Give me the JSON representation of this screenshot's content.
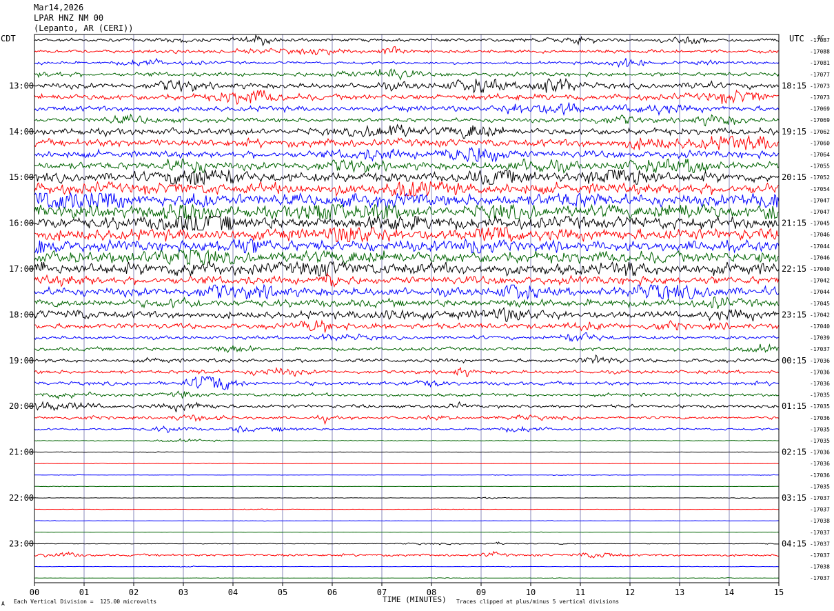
{
  "header": {
    "date": "Mar14,2026",
    "station": "LPAR HNZ NM 00",
    "location": "(Lepanto, AR (CERI))"
  },
  "left_zone": "CDT",
  "right_zone": "UTC",
  "right_top_corner": "0C",
  "footer": {
    "xlabel": "TIME (MINUTES)",
    "left_note": "Each Vertical Division =  125.00 microvolts",
    "right_note": "Traces clipped at plus/minus 5 vertical divisions",
    "corner_mark": "A"
  },
  "colors": {
    "cycle": [
      "#000000",
      "#ff0000",
      "#0000ff",
      "#006400"
    ],
    "grid": "#6a6aa8",
    "frame": "#000000"
  },
  "chart_data": {
    "type": "line",
    "title": "",
    "xlabel": "TIME (MINUTES)",
    "ylabel": "",
    "xlim": [
      0,
      15
    ],
    "x_tick_labels": [
      "00",
      "01",
      "02",
      "03",
      "04",
      "05",
      "06",
      "07",
      "08",
      "09",
      "10",
      "11",
      "12",
      "13",
      "14",
      "15"
    ],
    "trace_minutes": 15,
    "left_hour_labels": [
      {
        "trace_index": 4,
        "label": "13:00"
      },
      {
        "trace_index": 8,
        "label": "14:00"
      },
      {
        "trace_index": 12,
        "label": "15:00"
      },
      {
        "trace_index": 16,
        "label": "16:00"
      },
      {
        "trace_index": 20,
        "label": "17:00"
      },
      {
        "trace_index": 24,
        "label": "18:00"
      },
      {
        "trace_index": 28,
        "label": "19:00"
      },
      {
        "trace_index": 32,
        "label": "20:00"
      },
      {
        "trace_index": 36,
        "label": "21:00"
      },
      {
        "trace_index": 40,
        "label": "22:00"
      },
      {
        "trace_index": 44,
        "label": "23:00"
      }
    ],
    "right_time_labels": [
      {
        "trace_index": 4,
        "label": "18:15"
      },
      {
        "trace_index": 8,
        "label": "19:15"
      },
      {
        "trace_index": 12,
        "label": "20:15"
      },
      {
        "trace_index": 16,
        "label": "21:15"
      },
      {
        "trace_index": 20,
        "label": "22:15"
      },
      {
        "trace_index": 24,
        "label": "23:15"
      },
      {
        "trace_index": 28,
        "label": "00:15"
      },
      {
        "trace_index": 32,
        "label": "01:15"
      },
      {
        "trace_index": 36,
        "label": "02:15"
      },
      {
        "trace_index": 40,
        "label": "03:15"
      },
      {
        "trace_index": 44,
        "label": "04:15"
      }
    ],
    "trace_offsets": [
      "-17087",
      "-17088",
      "-17081",
      "-17077",
      "-17073",
      "-17073",
      "-17069",
      "-17069",
      "-17062",
      "-17060",
      "-17064",
      "-17055",
      "-17052",
      "-17054",
      "-17047",
      "-17047",
      "-17045",
      "-17046",
      "-17044",
      "-17046",
      "-17040",
      "-17042",
      "-17044",
      "-17045",
      "-17042",
      "-17040",
      "-17039",
      "-17037",
      "-17036",
      "-17036",
      "-17036",
      "-17035",
      "-17035",
      "-17036",
      "-17035",
      "-17035",
      "-17036",
      "-17036",
      "-17036",
      "-17035",
      "-17037",
      "-17037",
      "-17038",
      "-17037",
      "-17037",
      "-17037",
      "-17038",
      "-17037"
    ],
    "trace_amplitude_divisions": [
      1.2,
      1.3,
      1.1,
      1.6,
      2.2,
      2.4,
      2.1,
      1.7,
      2.6,
      3.0,
      2.8,
      3.0,
      3.8,
      4.4,
      4.6,
      4.8,
      4.9,
      4.5,
      4.2,
      4.6,
      4.7,
      3.2,
      3.4,
      3.0,
      2.8,
      2.2,
      1.4,
      1.4,
      1.5,
      1.4,
      1.5,
      1.3,
      1.3,
      1.1,
      0.9,
      0.3,
      0.15,
      0.12,
      0.12,
      0.1,
      0.12,
      0.12,
      0.12,
      0.1,
      0.25,
      0.9,
      0.15,
      0.1
    ],
    "vertical_division_microvolts": 125.0,
    "clip_divisions": 5
  }
}
